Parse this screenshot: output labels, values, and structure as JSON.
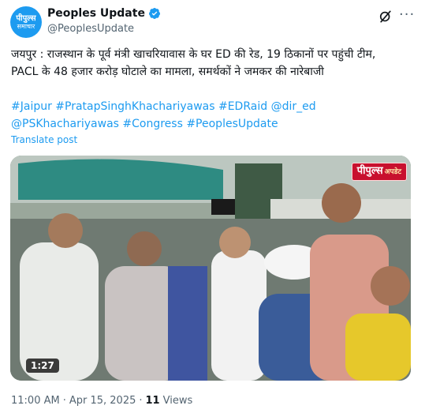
{
  "author": {
    "avatar_line1": "पीपुल्स",
    "avatar_line2": "समाचार",
    "name": "Peoples Update",
    "handle": "@PeoplesUpdate"
  },
  "tweet": {
    "text": "जयपुर : राजस्थान के पूर्व मंत्री खाचरियावास के घर ED की रेड, 19 ठिकानों पर पहुंची टीम, PACL के 48 हजार करोड़ घोटाले का मामला, समर्थकों ने जमकर की नारेबाजी",
    "hashtags_line1": "#Jaipur #PratapSinghKhachariyawas #EDRaid @dir_ed",
    "hashtags_line2": "@PSKhachariyawas #Congress #PeoplesUpdate",
    "translate_label": "Translate post"
  },
  "media": {
    "brand_main": "पीपुल्स",
    "brand_sub": "अपडेट",
    "duration": "1:27"
  },
  "meta": {
    "time": "11:00 AM",
    "separator": "·",
    "date": "Apr 15, 2025",
    "separator2": "·",
    "views_count": "11",
    "views_label": "Views"
  },
  "icons": {
    "verified": "verified-badge-icon",
    "grok": "grok-icon",
    "more": "more-options-icon"
  },
  "colors": {
    "accent": "#1d9bf0",
    "text": "#0f1419",
    "muted": "#536471"
  }
}
